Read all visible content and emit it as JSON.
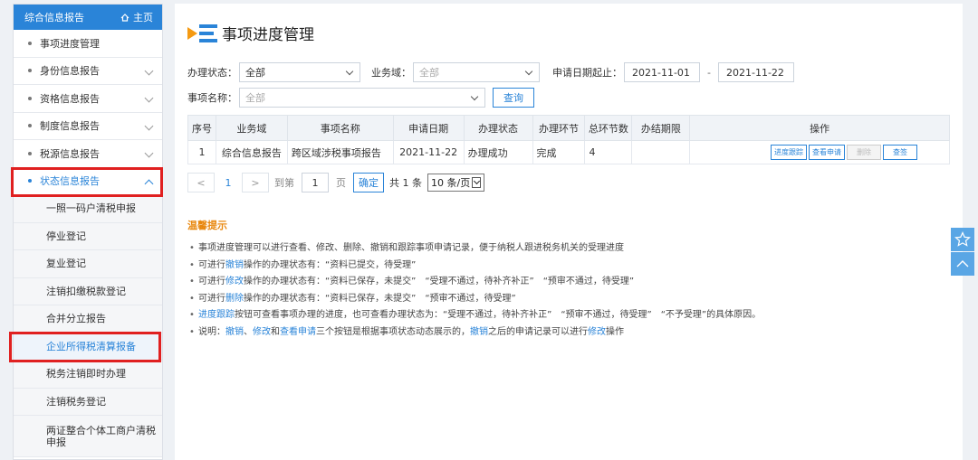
{
  "sidebar": {
    "header_title": "综合信息报告",
    "home_label": "主页",
    "items": [
      {
        "label": "事项进度管理",
        "has_chevron": false
      },
      {
        "label": "身份信息报告",
        "has_chevron": true
      },
      {
        "label": "资格信息报告",
        "has_chevron": true
      },
      {
        "label": "制度信息报告",
        "has_chevron": true
      },
      {
        "label": "税源信息报告",
        "has_chevron": true
      },
      {
        "label": "状态信息报告",
        "has_chevron": true,
        "expanded": true
      }
    ],
    "sub_items": [
      {
        "label": "一照一码户清税申报"
      },
      {
        "label": "停业登记"
      },
      {
        "label": "复业登记"
      },
      {
        "label": "注销扣缴税款登记"
      },
      {
        "label": "合并分立报告"
      },
      {
        "label": "企业所得税清算报备",
        "selected": true
      },
      {
        "label": "税务注销即时办理"
      },
      {
        "label": "注销税务登记"
      },
      {
        "label": "两证整合个体工商户清税申报"
      }
    ]
  },
  "page": {
    "title": "事项进度管理"
  },
  "filters": {
    "status_label": "办理状态：",
    "status_value": "全部",
    "domain_label": "业务域：",
    "domain_value": "全部",
    "date_label": "申请日期起止：",
    "date_from": "2021-11-01",
    "date_sep": "-",
    "date_to": "2021-11-22",
    "name_label": "事项名称：",
    "name_value": "全部",
    "query_button": "查询"
  },
  "table": {
    "columns": [
      "序号",
      "业务域",
      "事项名称",
      "申请日期",
      "办理状态",
      "办理环节",
      "总环节数",
      "办结期限",
      "操作"
    ],
    "rows": [
      {
        "index": "1",
        "domain": "综合信息报告",
        "name": "跨区域涉税事项报告",
        "date": "2021-11-22",
        "status": "办理成功",
        "stage": "完成",
        "total": "4",
        "deadline": "",
        "actions": [
          "进度跟踪",
          "查看申请",
          "删除",
          "查签"
        ]
      }
    ]
  },
  "pager": {
    "prev": "<",
    "current": "1",
    "next": ">",
    "goto_label": "到第",
    "goto_value": "1",
    "page_unit": "页",
    "confirm": "确定",
    "total": "共 1 条",
    "page_size": "10 条/页"
  },
  "tips": {
    "title": "温馨提示",
    "lines": [
      [
        {
          "t": "事项进度管理可以进行查看、修改、删除、撤销和跟踪事项申请记录，便于纳税人跟进税务机关的受理进度"
        }
      ],
      [
        {
          "t": "可进行"
        },
        {
          "t": "撤销",
          "hl": true
        },
        {
          "t": "操作的办理状态有：“资料已提交，待受理”"
        }
      ],
      [
        {
          "t": "可进行"
        },
        {
          "t": "修改",
          "hl": true
        },
        {
          "t": "操作的办理状态有：“资料已保存，未提交”　“受理不通过，待补齐补正”　“预审不通过，待受理”"
        }
      ],
      [
        {
          "t": "可进行"
        },
        {
          "t": "删除",
          "hl": true
        },
        {
          "t": "操作的办理状态有：“资料已保存，未提交”　“预审不通过，待受理”"
        }
      ],
      [
        {
          "t": "进度跟踪",
          "hl": true
        },
        {
          "t": "按钮可查看事项办理的进度，也可查看办理状态为：“受理不通过，待补齐补正”　“预审不通过，待受理”　“不予受理”的具体原因。"
        }
      ],
      [
        {
          "t": "说明："
        },
        {
          "t": "撤销",
          "hl": true
        },
        {
          "t": "、"
        },
        {
          "t": "修改",
          "hl": true
        },
        {
          "t": "和"
        },
        {
          "t": "查看申请",
          "hl": true
        },
        {
          "t": "三个按钮是根据事项状态动态展示的，"
        },
        {
          "t": "撤销",
          "hl": true
        },
        {
          "t": "之后的申请记录可以进行"
        },
        {
          "t": "修改",
          "hl": true
        },
        {
          "t": "操作"
        }
      ]
    ]
  },
  "colors": {
    "accent": "#2a84d8",
    "highlight_box": "#e02020",
    "tips_title": "#e8870d",
    "title_icon_orange": "#f59a12"
  },
  "icons": [
    "home-icon",
    "chevron-down-icon",
    "chevron-up-icon",
    "star-icon",
    "back-to-top-icon"
  ]
}
